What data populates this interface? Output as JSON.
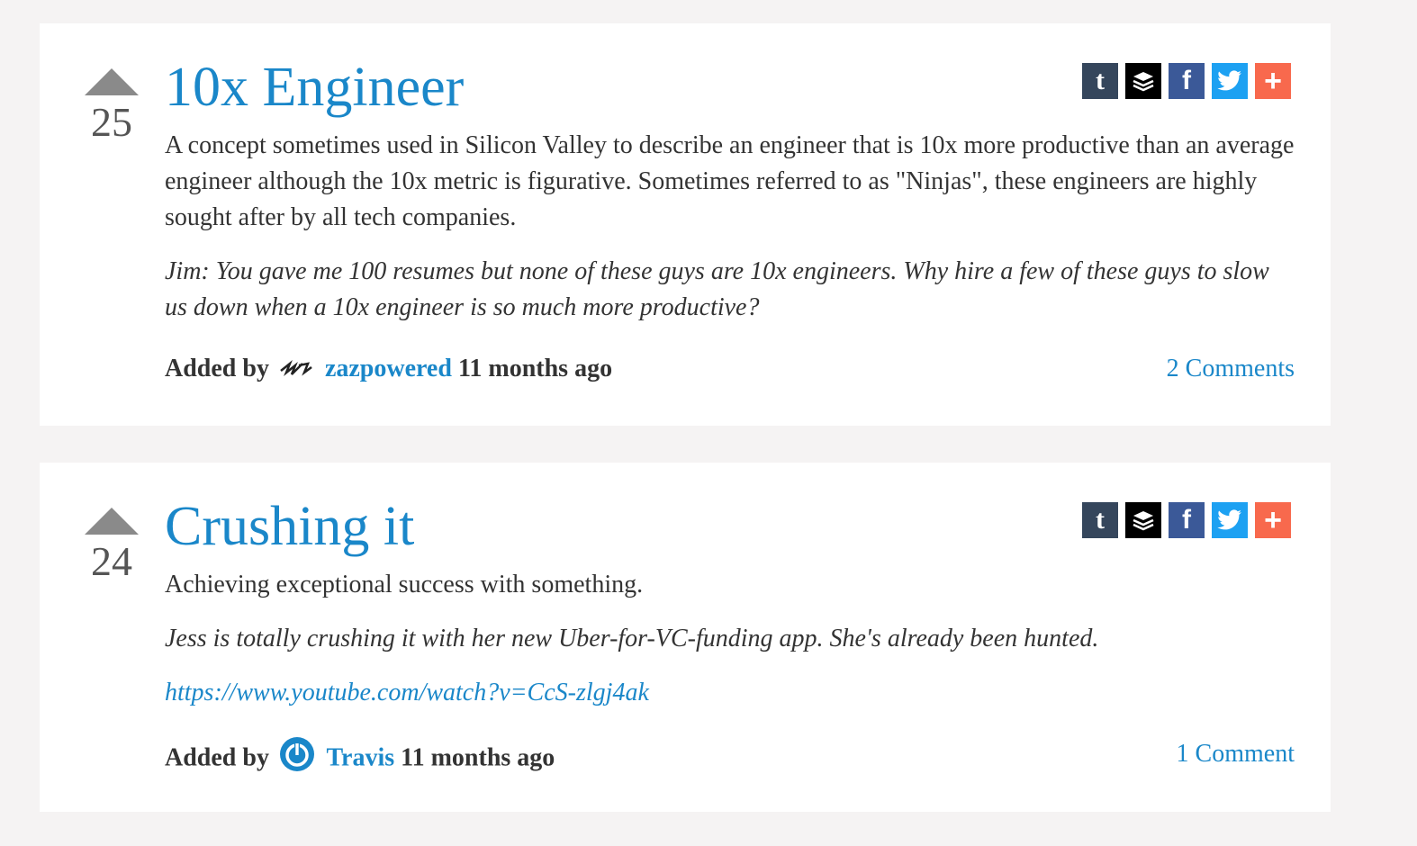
{
  "posts": [
    {
      "votes": "25",
      "title": "10x Engineer",
      "definition": "A concept sometimes used in Silicon Valley to describe an engineer that is 10x more productive than an average engineer although the 10x metric is figurative. Sometimes referred to as \"Ninjas\", these engineers are highly sought after by all tech companies.",
      "example": "Jim: You gave me 100 resumes but none of these guys are 10x engineers. Why hire a few of these guys to slow us down when a 10x engineer is so much more productive?",
      "added_by_label": "Added by",
      "user": "zazpowered",
      "time": "11 months ago",
      "comments": "2 Comments"
    },
    {
      "votes": "24",
      "title": "Crushing it",
      "definition": "Achieving exceptional success with something.",
      "example": "Jess is totally crushing it with her new Uber-for-VC-funding app. She's already been hunted.",
      "link": "https://www.youtube.com/watch?v=CcS-zlgj4ak",
      "added_by_label": "Added by",
      "user": "Travis",
      "time": "11 months ago",
      "comments": "1 Comment"
    }
  ],
  "share_buttons": [
    {
      "name": "tumblr-icon",
      "glyph": "t",
      "color": "#35465c"
    },
    {
      "name": "buffer-icon",
      "glyph": "",
      "color": "#000000"
    },
    {
      "name": "facebook-icon",
      "glyph": "f",
      "color": "#3b5998"
    },
    {
      "name": "twitter-icon",
      "glyph": "",
      "color": "#1da1f2"
    },
    {
      "name": "more-share-icon",
      "glyph": "+",
      "color": "#f8694d"
    }
  ],
  "colors": {
    "link_blue": "#1a87c9",
    "page_bg": "#f5f3f3",
    "card_bg": "#ffffff",
    "vote_arrow": "#8a8a8a"
  }
}
